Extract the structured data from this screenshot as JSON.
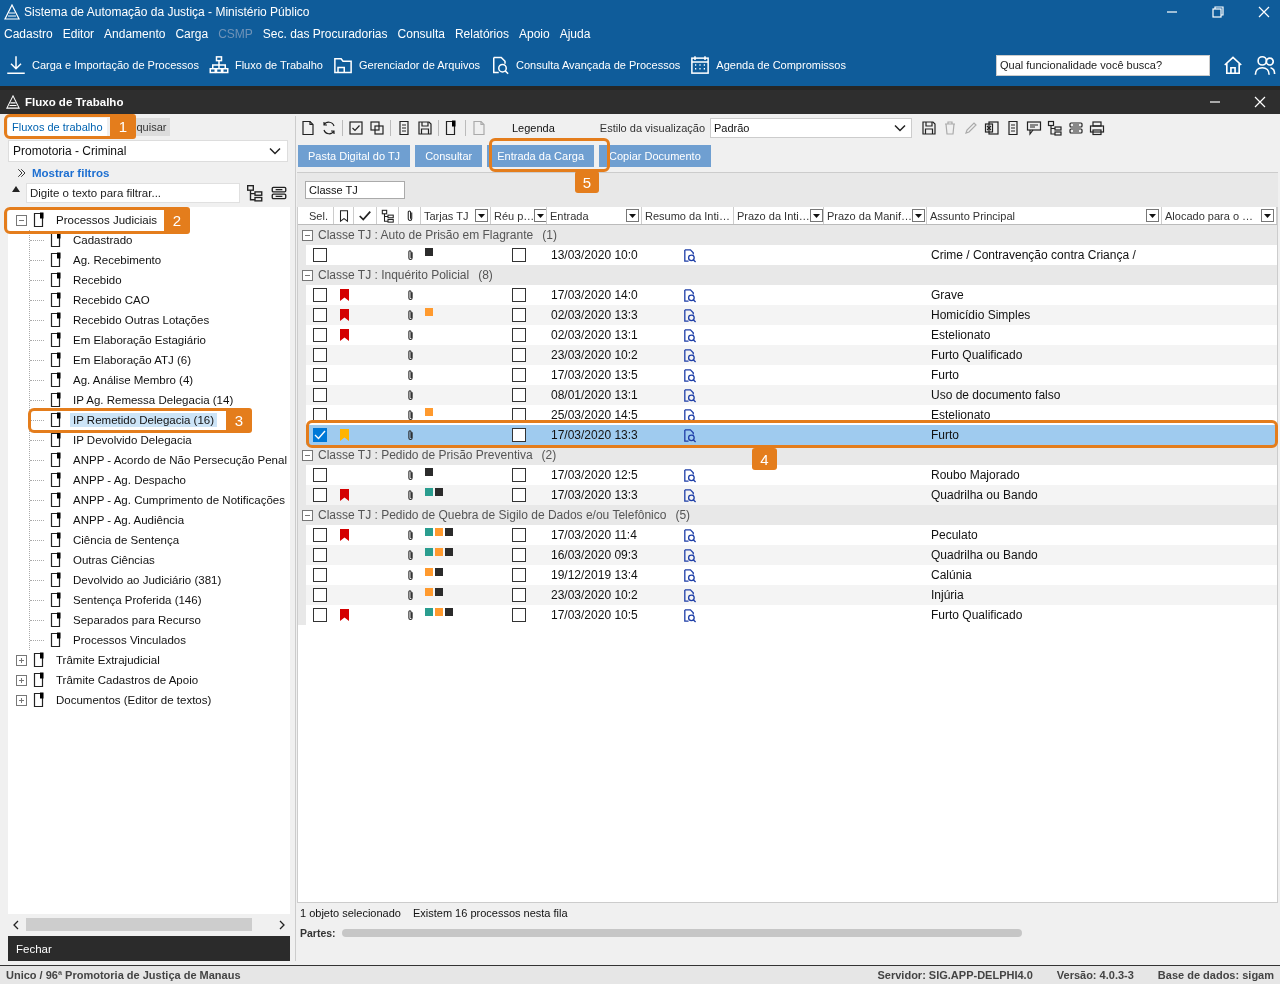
{
  "window": {
    "title": "Sistema de Automação da Justiça - Ministério Público"
  },
  "menu": [
    {
      "label": "Cadastro",
      "disabled": false
    },
    {
      "label": "Editor",
      "disabled": false
    },
    {
      "label": "Andamento",
      "disabled": false
    },
    {
      "label": "Carga",
      "disabled": false
    },
    {
      "label": "CSMP",
      "disabled": true
    },
    {
      "label": "Sec. das Procuradorias",
      "disabled": false
    },
    {
      "label": "Consulta",
      "disabled": false
    },
    {
      "label": "Relatórios",
      "disabled": false
    },
    {
      "label": "Apoio",
      "disabled": false
    },
    {
      "label": "Ajuda",
      "disabled": false
    }
  ],
  "toolbar": [
    {
      "label": "Carga e Importação de Processos"
    },
    {
      "label": "Fluxo de Trabalho"
    },
    {
      "label": "Gerenciador de Arquivos"
    },
    {
      "label": "Consulta Avançada de Processos"
    },
    {
      "label": "Agenda de Compromissos"
    }
  ],
  "search": {
    "placeholder": "Qual funcionalidade você busca?"
  },
  "subwindow": {
    "title": "Fluxo de Trabalho"
  },
  "left": {
    "tabs": [
      {
        "label": "Fluxos de trabalho",
        "selected": true
      },
      {
        "label": "quisar",
        "selected": false
      }
    ],
    "unit": "Promotoria - Criminal",
    "filters_link": "Mostrar filtros",
    "filter": {
      "placeholder": "Digite o texto para filtrar..."
    },
    "tree": [
      {
        "label": "Processos Judiciais",
        "expanded": true,
        "selected": false,
        "children": [
          {
            "label": "Cadastrado",
            "selected": false
          },
          {
            "label": "Ag. Recebimento",
            "selected": false
          },
          {
            "label": "Recebido",
            "selected": false
          },
          {
            "label": "Recebido CAO",
            "selected": false
          },
          {
            "label": "Recebido Outras Lotações",
            "selected": false
          },
          {
            "label": "Em Elaboração Estagiário",
            "selected": false
          },
          {
            "label": "Em Elaboração ATJ (6)",
            "selected": false
          },
          {
            "label": "Ag. Análise Membro (4)",
            "selected": false
          },
          {
            "label": "IP Ag. Remessa Delegacia (14)",
            "selected": false
          },
          {
            "label": "IP Remetido Delegacia (16)",
            "selected": true
          },
          {
            "label": "IP Devolvido Delegacia",
            "selected": false
          },
          {
            "label": "ANPP - Acordo de Não Persecução Penal",
            "selected": false
          },
          {
            "label": "ANPP - Ag. Despacho",
            "selected": false
          },
          {
            "label": "ANPP - Ag. Cumprimento de Notificações",
            "selected": false
          },
          {
            "label": "ANPP - Ag. Audiência",
            "selected": false
          },
          {
            "label": "Ciência de Sentença",
            "selected": false
          },
          {
            "label": "Outras Ciências",
            "selected": false
          },
          {
            "label": "Devolvido ao Judiciário (381)",
            "selected": false
          },
          {
            "label": "Sentença Proferida (146)",
            "selected": false
          },
          {
            "label": "Separados para Recurso",
            "selected": false
          },
          {
            "label": "Processos Vinculados",
            "selected": false
          }
        ]
      },
      {
        "label": "Trâmite Extrajudicial",
        "expanded": false,
        "selected": false
      },
      {
        "label": "Trâmite Cadastros de Apoio",
        "expanded": false,
        "selected": false
      },
      {
        "label": "Documentos (Editor de textos)",
        "expanded": false,
        "selected": false
      }
    ],
    "close_button": "Fechar"
  },
  "right": {
    "legend": "Legenda",
    "view_style_label": "Estilo da visualização",
    "view_style": "Padrão",
    "actions": [
      {
        "label": "Pasta Digital do TJ"
      },
      {
        "label": "Consultar"
      },
      {
        "label": "Entrada da Carga"
      },
      {
        "label": "Copiar Documento"
      }
    ],
    "group_chip": "Classe TJ",
    "columns": [
      {
        "label": "Sel.",
        "filter": false
      },
      {
        "label": "Tarjas TJ",
        "filter": true
      },
      {
        "label": "Réu p…",
        "filter": true
      },
      {
        "label": "Entrada",
        "filter": true
      },
      {
        "label": "Resumo da Inti…",
        "filter": false
      },
      {
        "label": "Prazo da Inti…",
        "filter": true
      },
      {
        "label": "Prazo da Manif…",
        "filter": true
      },
      {
        "label": "Assunto Principal",
        "filter": true
      },
      {
        "label": "Alocado para o …",
        "filter": true
      }
    ],
    "groups": [
      {
        "title": "Classe TJ : Auto de Prisão em Flagrante",
        "count": "(1)",
        "expanded": true,
        "rows": [
          {
            "checked": false,
            "tarjas": [
              {
                "color": "#2b2b2b"
              }
            ],
            "defendant_checked": false,
            "entry": "13/03/2020 10:0",
            "subject": "Crime / Contravenção contra Criança /",
            "selected": false
          }
        ]
      },
      {
        "title": "Classe TJ : Inquérito Policial",
        "count": "(8)",
        "expanded": true,
        "rows": [
          {
            "checked": false,
            "bookmark": {
              "color": "#d40000"
            },
            "tarjas": [],
            "defendant_checked": false,
            "entry": "17/03/2020 14:0",
            "subject": "Grave",
            "selected": false
          },
          {
            "checked": false,
            "bookmark": {
              "color": "#d40000"
            },
            "tarjas": [
              {
                "color": "#ff9a2e"
              }
            ],
            "defendant_checked": false,
            "entry": "02/03/2020 13:3",
            "subject": "Homicídio Simples",
            "selected": false
          },
          {
            "checked": false,
            "bookmark": {
              "color": "#d40000"
            },
            "tarjas": [],
            "defendant_checked": false,
            "entry": "02/03/2020 13:1",
            "subject": "Estelionato",
            "selected": false
          },
          {
            "checked": false,
            "tarjas": [],
            "defendant_checked": false,
            "entry": "23/03/2020 10:2",
            "subject": "Furto Qualificado",
            "selected": false
          },
          {
            "checked": false,
            "tarjas": [],
            "defendant_checked": false,
            "entry": "17/03/2020 13:5",
            "subject": "Furto",
            "selected": false
          },
          {
            "checked": false,
            "tarjas": [],
            "defendant_checked": false,
            "entry": "08/01/2020 13:1",
            "subject": "Uso de documento falso",
            "selected": false
          },
          {
            "checked": false,
            "tarjas": [
              {
                "color": "#ff9a2e"
              }
            ],
            "defendant_checked": false,
            "entry": "25/03/2020 14:5",
            "subject": "Estelionato",
            "selected": false
          },
          {
            "checked": true,
            "bookmark": {
              "color": "#ffb400"
            },
            "tarjas": [],
            "defendant_checked": false,
            "entry": "17/03/2020 13:3",
            "subject": "Furto",
            "selected": true
          }
        ]
      },
      {
        "title": "Classe TJ : Pedido de Prisão Preventiva",
        "count": "(2)",
        "expanded": true,
        "rows": [
          {
            "checked": false,
            "tarjas": [
              {
                "color": "#2b2b2b"
              }
            ],
            "defendant_checked": false,
            "entry": "17/03/2020 12:5",
            "subject": "Roubo Majorado",
            "selected": false
          },
          {
            "checked": false,
            "bookmark": {
              "color": "#d40000"
            },
            "tarjas": [
              {
                "color": "#2a9d8f"
              },
              {
                "color": "#2b2b2b"
              }
            ],
            "defendant_checked": false,
            "entry": "17/03/2020 13:3",
            "subject": "Quadrilha ou Bando",
            "selected": false
          }
        ]
      },
      {
        "title": "Classe TJ : Pedido de Quebra de Sigilo de Dados e/ou Telefônico",
        "count": "(5)",
        "expanded": true,
        "rows": [
          {
            "checked": false,
            "bookmark": {
              "color": "#d40000"
            },
            "tarjas": [
              {
                "color": "#2a9d8f"
              },
              {
                "color": "#ff9a2e"
              },
              {
                "color": "#2b2b2b"
              }
            ],
            "defendant_checked": false,
            "entry": "17/03/2020 11:4",
            "subject": "Peculato",
            "selected": false
          },
          {
            "checked": false,
            "tarjas": [
              {
                "color": "#2a9d8f"
              },
              {
                "color": "#ff9a2e"
              },
              {
                "color": "#2b2b2b"
              }
            ],
            "defendant_checked": false,
            "entry": "16/03/2020 09:3",
            "subject": "Quadrilha ou Bando",
            "selected": false
          },
          {
            "checked": false,
            "tarjas": [
              {
                "color": "#ff9a2e"
              },
              {
                "color": "#2b2b2b"
              }
            ],
            "defendant_checked": false,
            "entry": "19/12/2019 13:4",
            "subject": "Calúnia",
            "selected": false
          },
          {
            "checked": false,
            "tarjas": [
              {
                "color": "#ff9a2e"
              },
              {
                "color": "#2b2b2b"
              }
            ],
            "defendant_checked": false,
            "entry": "23/03/2020 10:2",
            "subject": "Injúria",
            "selected": false
          },
          {
            "checked": false,
            "bookmark": {
              "color": "#d40000"
            },
            "tarjas": [
              {
                "color": "#2a9d8f"
              },
              {
                "color": "#ff9a2e"
              },
              {
                "color": "#2b2b2b"
              }
            ],
            "defendant_checked": false,
            "entry": "17/03/2020 10:5",
            "subject": "Furto Qualificado",
            "selected": false
          }
        ]
      }
    ],
    "selection_info": "1 objeto selecionado",
    "queue_info": "Existem 16 processos nesta fila",
    "parties_label": "Partes:"
  },
  "status_bar": {
    "left": "Unico / 96ª Promotoria de Justiça de Manaus",
    "items": [
      {
        "text": "Servidor: SIG.APP-DELPHI4.0"
      },
      {
        "text": "Versão: 4.0.3-3"
      },
      {
        "text": "Base de dados: sigam"
      }
    ]
  },
  "callouts": [
    {
      "number": "1"
    },
    {
      "number": "2"
    },
    {
      "number": "3"
    },
    {
      "number": "4"
    },
    {
      "number": "5"
    }
  ]
}
